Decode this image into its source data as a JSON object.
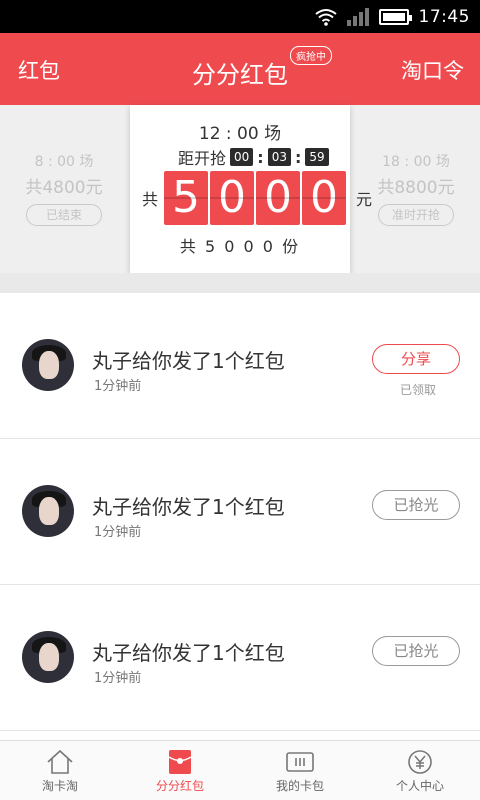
{
  "status_bar": {
    "time": "17:45",
    "signal_label": "2"
  },
  "header": {
    "left": "红包",
    "title": "分分红包",
    "badge": "疯抢中",
    "right": "淘口令",
    "accent_color": "#ef4b4f"
  },
  "sessions": {
    "left": {
      "time": "8 : 00 场",
      "total": "共4800元",
      "button": "已结束"
    },
    "center": {
      "time": "12 : 00 场",
      "countdown_label": "距开抢",
      "countdown": [
        "00",
        "03",
        "59"
      ],
      "prefix": "共",
      "digits": [
        "5",
        "0",
        "0",
        "0"
      ],
      "unit": "元",
      "shares": "共 5 0 0 0 份"
    },
    "right": {
      "time": "18 : 00 场",
      "total": "共8800元",
      "button": "准时开抢"
    }
  },
  "list": [
    {
      "message": "丸子给你发了1个红包",
      "time_ago": "1分钟前",
      "action": "分享",
      "status": "已领取"
    },
    {
      "message": "丸子给你发了1个红包",
      "time_ago": "1分钟前",
      "action": "已抢光"
    },
    {
      "message": "丸子给你发了1个红包",
      "time_ago": "1分钟前",
      "action": "已抢光"
    }
  ],
  "tabs": [
    {
      "label": "淘卡淘",
      "icon": "home-icon"
    },
    {
      "label": "分分红包",
      "icon": "red-envelope-icon"
    },
    {
      "label": "我的卡包",
      "icon": "card-icon"
    },
    {
      "label": "个人中心",
      "icon": "yuan-icon"
    }
  ]
}
